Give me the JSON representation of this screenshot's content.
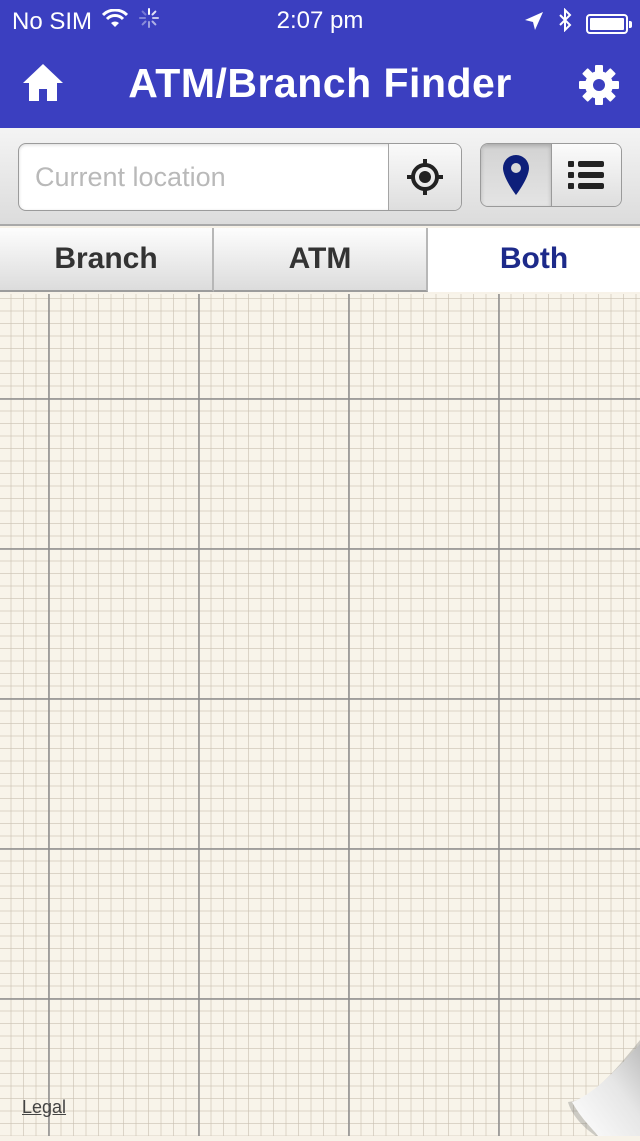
{
  "status_bar": {
    "carrier": "No SIM",
    "time": "2:07 pm"
  },
  "header": {
    "title": "ATM/Branch Finder",
    "home_icon": "home-icon",
    "settings_icon": "gear-icon",
    "bg_color": "#3b3fc0"
  },
  "search": {
    "placeholder": "Current location",
    "value": "",
    "locate_icon": "crosshair-icon"
  },
  "view_toggle": {
    "options": [
      "map-pin-icon",
      "list-icon"
    ],
    "selected": "map"
  },
  "tabs": {
    "items": [
      {
        "label": "Branch",
        "selected": false
      },
      {
        "label": "ATM",
        "selected": false
      },
      {
        "label": "Both",
        "selected": true
      }
    ],
    "selected_color": "#1d2a8a"
  },
  "map": {
    "legal_label": "Legal"
  }
}
